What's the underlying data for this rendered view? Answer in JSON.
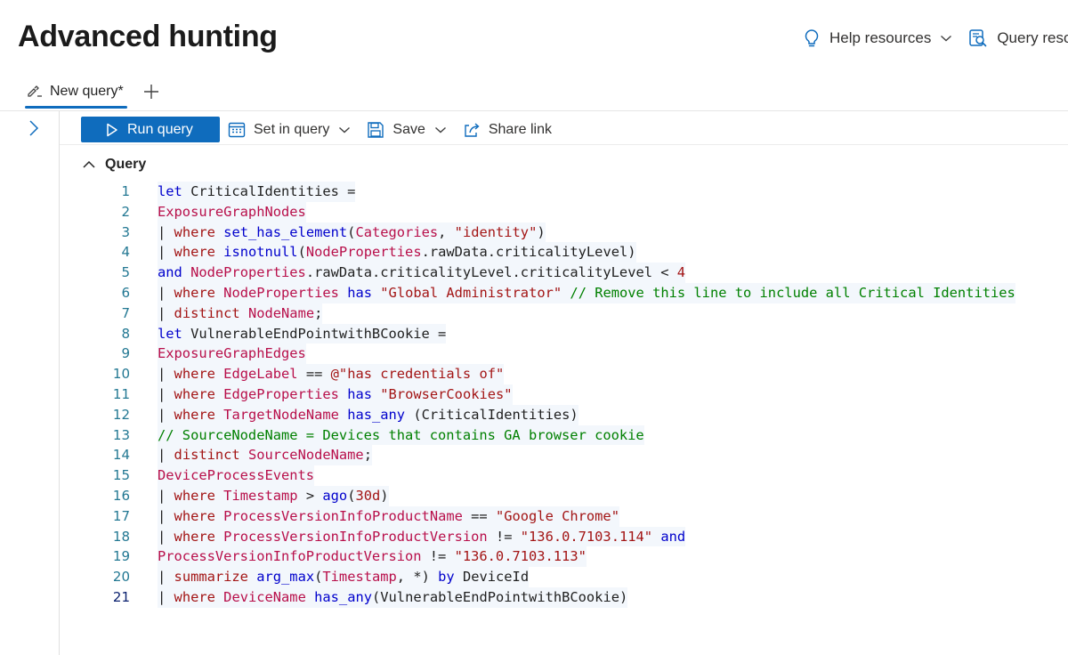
{
  "header": {
    "title": "Advanced hunting",
    "help_label": "Help resources",
    "query_resources_label": "Query resou"
  },
  "tabs": [
    {
      "label": "New query*",
      "active": true
    }
  ],
  "toolbar": {
    "run_label": "Run query",
    "set_in_query_label": "Set in query",
    "save_label": "Save",
    "share_label": "Share link"
  },
  "query_section": {
    "label": "Query"
  },
  "editor": {
    "line_numbers": [
      "1",
      "2",
      "3",
      "4",
      "5",
      "6",
      "7",
      "8",
      "9",
      "10",
      "11",
      "12",
      "13",
      "14",
      "15",
      "16",
      "17",
      "18",
      "19",
      "20",
      "21"
    ],
    "lines": [
      "let CriticalIdentities =",
      "ExposureGraphNodes",
      "| where set_has_element(Categories, \"identity\")",
      "| where isnotnull(NodeProperties.rawData.criticalityLevel)",
      "and NodeProperties.rawData.criticalityLevel.criticalityLevel < 4",
      "| where NodeProperties has \"Global Administrator\" // Remove this line to include all Critical Identities",
      "| distinct NodeName;",
      "let VulnerableEndPointwithBCookie =",
      "ExposureGraphEdges",
      "| where EdgeLabel == @\"has credentials of\"",
      "| where EdgeProperties has \"BrowserCookies\"",
      "| where TargetNodeName has_any (CriticalIdentities)",
      "// SourceNodeName = Devices that contains GA browser cookie",
      "| distinct SourceNodeName;",
      "DeviceProcessEvents",
      "| where Timestamp > ago(30d)",
      "| where ProcessVersionInfoProductName == \"Google Chrome\"",
      "| where ProcessVersionInfoProductVersion != \"136.0.7103.114\" and",
      "ProcessVersionInfoProductVersion != \"136.0.7103.113\"",
      "| summarize arg_max(Timestamp, *) by DeviceId",
      "| where DeviceName has_any(VulnerableEndPointwithBCookie)"
    ]
  },
  "colors": {
    "accent": "#0f6cbd",
    "keyword": "#0000cc",
    "table": "#b80f4a",
    "string": "#a31515",
    "comment": "#008000",
    "line_number": "#237893"
  },
  "icons": [
    "lightbulb-icon",
    "chevron-down-icon",
    "query-resources-icon",
    "query-pen-icon",
    "plus-icon",
    "chevron-right-icon",
    "play-icon",
    "calendar-icon",
    "save-icon",
    "share-icon",
    "chevron-up-icon"
  ]
}
